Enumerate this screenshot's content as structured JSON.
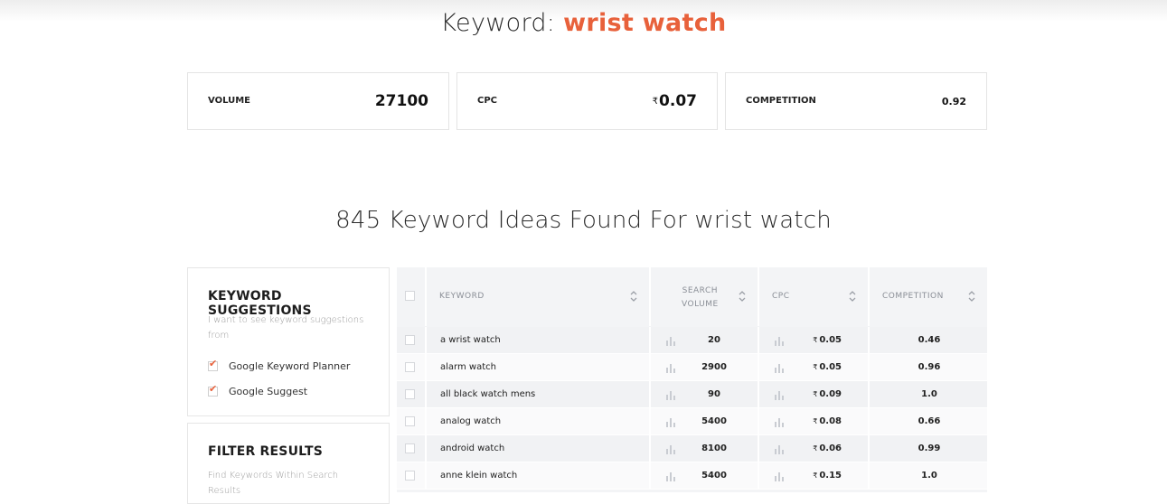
{
  "header": {
    "title_prefix": "Keyword: ",
    "keyword": "wrist watch"
  },
  "stats": {
    "volume": {
      "label": "VOLUME",
      "value": "27100"
    },
    "cpc": {
      "label": "CPC",
      "currency": "₹",
      "value": "0.07"
    },
    "competition": {
      "label": "COMPETITION",
      "value": "0.92"
    }
  },
  "ideas_heading": "845 Keyword Ideas Found For wrist watch",
  "suggestions_panel": {
    "title": "KEYWORD SUGGESTIONS",
    "description": "I want to see keyword suggestions from",
    "options": [
      {
        "label": "Google Keyword Planner",
        "checked": true
      },
      {
        "label": "Google Suggest",
        "checked": true
      }
    ]
  },
  "filter_panel": {
    "title": "FILTER RESULTS",
    "description": "Find Keywords Within Search Results"
  },
  "table": {
    "columns": {
      "keyword": "KEYWORD",
      "search_volume_line1": "SEARCH",
      "search_volume_line2": "VOLUME",
      "cpc": "CPC",
      "competition": "COMPETITION"
    },
    "currency": "₹",
    "rows": [
      {
        "keyword": "a wrist watch",
        "volume": "20",
        "cpc": "0.05",
        "competition": "0.46"
      },
      {
        "keyword": "alarm watch",
        "volume": "2900",
        "cpc": "0.05",
        "competition": "0.96"
      },
      {
        "keyword": "all black watch mens",
        "volume": "90",
        "cpc": "0.09",
        "competition": "1.0"
      },
      {
        "keyword": "analog watch",
        "volume": "5400",
        "cpc": "0.08",
        "competition": "0.66"
      },
      {
        "keyword": "android watch",
        "volume": "8100",
        "cpc": "0.06",
        "competition": "0.99"
      },
      {
        "keyword": "anne klein watch",
        "volume": "5400",
        "cpc": "0.15",
        "competition": "1.0"
      }
    ]
  },
  "colors": {
    "accent": "#e8613b",
    "table_bg": "#f3f4f6",
    "header_text": "#8a8e96"
  }
}
